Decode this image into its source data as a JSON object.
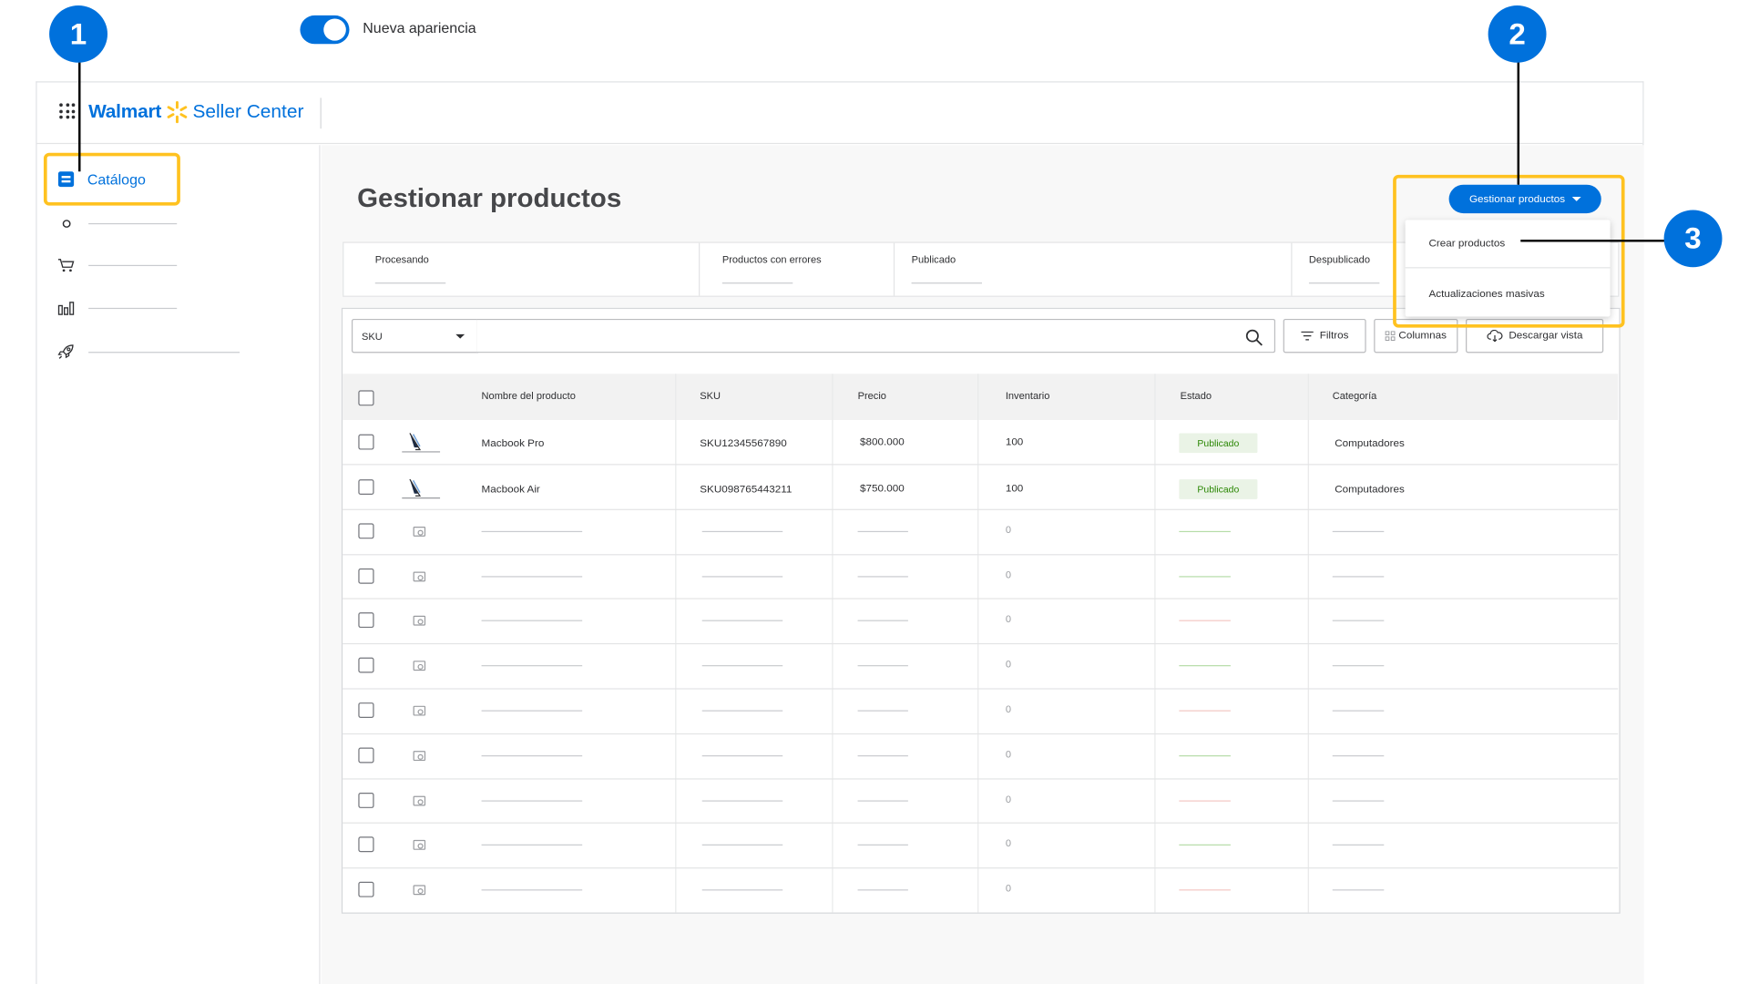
{
  "brand": {
    "walmart": "Walmart",
    "seller_center": "Seller Center",
    "spark_color": "#ffc220",
    "accent": "#0071dc"
  },
  "header": {
    "toggle_label": "Nueva apariencia",
    "toggle_on": true
  },
  "sidebar": {
    "active_item": {
      "label": "Catálogo",
      "icon": "catalog-icon"
    },
    "items": [
      {
        "icon": "circle-icon"
      },
      {
        "icon": "cart-icon"
      },
      {
        "icon": "bar-chart-icon"
      },
      {
        "icon": "rocket-icon"
      }
    ]
  },
  "main": {
    "title": "Gestionar productos",
    "manage_button": "Gestionar productos",
    "stats": [
      "Procesando",
      "Productos con errores",
      "Publicado",
      "Despublicado"
    ],
    "dropdown": [
      "Crear productos",
      "Actualizaciones masivas"
    ],
    "search": {
      "field": "SKU",
      "placeholder": ""
    },
    "toolbar": {
      "filters": "Filtros",
      "columns": "Columnas",
      "download": "Descargar vista"
    },
    "table": {
      "columns": [
        "Nombre del producto",
        "SKU",
        "Precio",
        "Inventario",
        "Estado",
        "Categoría"
      ],
      "rows": [
        {
          "name": "Macbook Pro",
          "sku": "SKU12345567890",
          "price": "$800.000",
          "inventory": "100",
          "status": "Publicado",
          "category": "Computadores"
        },
        {
          "name": "Macbook Air",
          "sku": "SKU098765443211",
          "price": "$750.000",
          "inventory": "100",
          "status": "Publicado",
          "category": "Computadores"
        }
      ],
      "placeholder_inventory": "0"
    }
  },
  "callouts": [
    "1",
    "2",
    "3"
  ],
  "highlight_color": "#ffc220"
}
